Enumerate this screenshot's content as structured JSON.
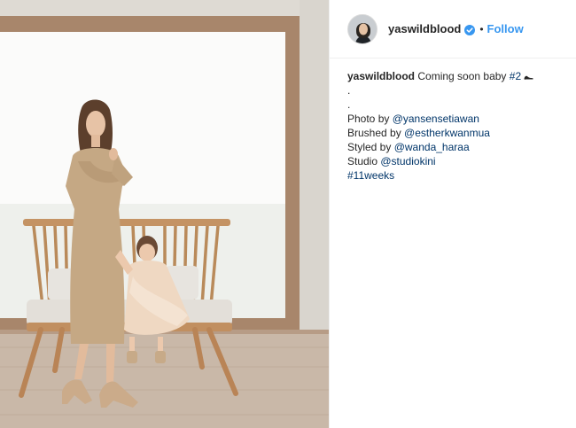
{
  "post": {
    "image_alt": "Woman in beige knit dress standing beside a toddler in a tulle dress seated on a wooden bench in front of a large window",
    "author": {
      "username": "yaswildblood",
      "verified": true,
      "avatar_icon": "profile-avatar"
    },
    "header": {
      "separator": "•",
      "follow_label": "Follow"
    },
    "caption": {
      "username": "yaswildblood",
      "text": "Coming soon baby ",
      "hashtag": "#2",
      "emoji_icon": "high-heel-icon",
      "dot_lines": [
        ".",
        "."
      ],
      "credits": [
        {
          "prefix": "Photo by ",
          "handle": "@yansensetiawan"
        },
        {
          "prefix": "Brushed by ",
          "handle": "@estherkwanmua"
        },
        {
          "prefix": "Styled by ",
          "handle": "@wanda_haraa"
        },
        {
          "prefix": "Studio ",
          "handle": "@studiokini"
        }
      ],
      "final_hashtag": "#11weeks"
    }
  },
  "colors": {
    "link": "#003569",
    "follow": "#3897f0",
    "verified_badge": "#3897f0",
    "text": "#262626",
    "border": "#efefef"
  }
}
